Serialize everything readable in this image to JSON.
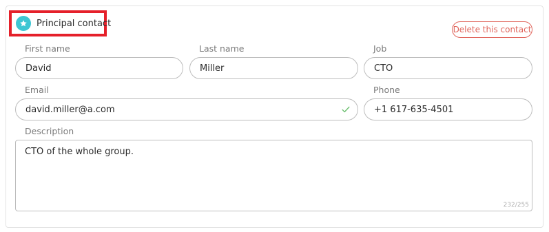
{
  "contact": {
    "principal_label": "Principal contact",
    "delete_label": "Delete this contact"
  },
  "fields": {
    "first_name": {
      "label": "First name",
      "value": "David"
    },
    "last_name": {
      "label": "Last name",
      "value": "Miller"
    },
    "job": {
      "label": "Job",
      "value": "CTO"
    },
    "email": {
      "label": "Email",
      "value": "david.miller@a.com",
      "valid": true
    },
    "phone": {
      "label": "Phone",
      "value": "+1 617-635-4501"
    },
    "description": {
      "label": "Description",
      "value": "CTO of the whole group.",
      "counter": "232/255"
    }
  },
  "colors": {
    "accent": "#3ec6d3",
    "danger": "#e0645b",
    "highlight": "#e5202a",
    "valid": "#6cc070"
  },
  "icons": {
    "principal": "star-icon",
    "email_valid": "check-icon"
  }
}
